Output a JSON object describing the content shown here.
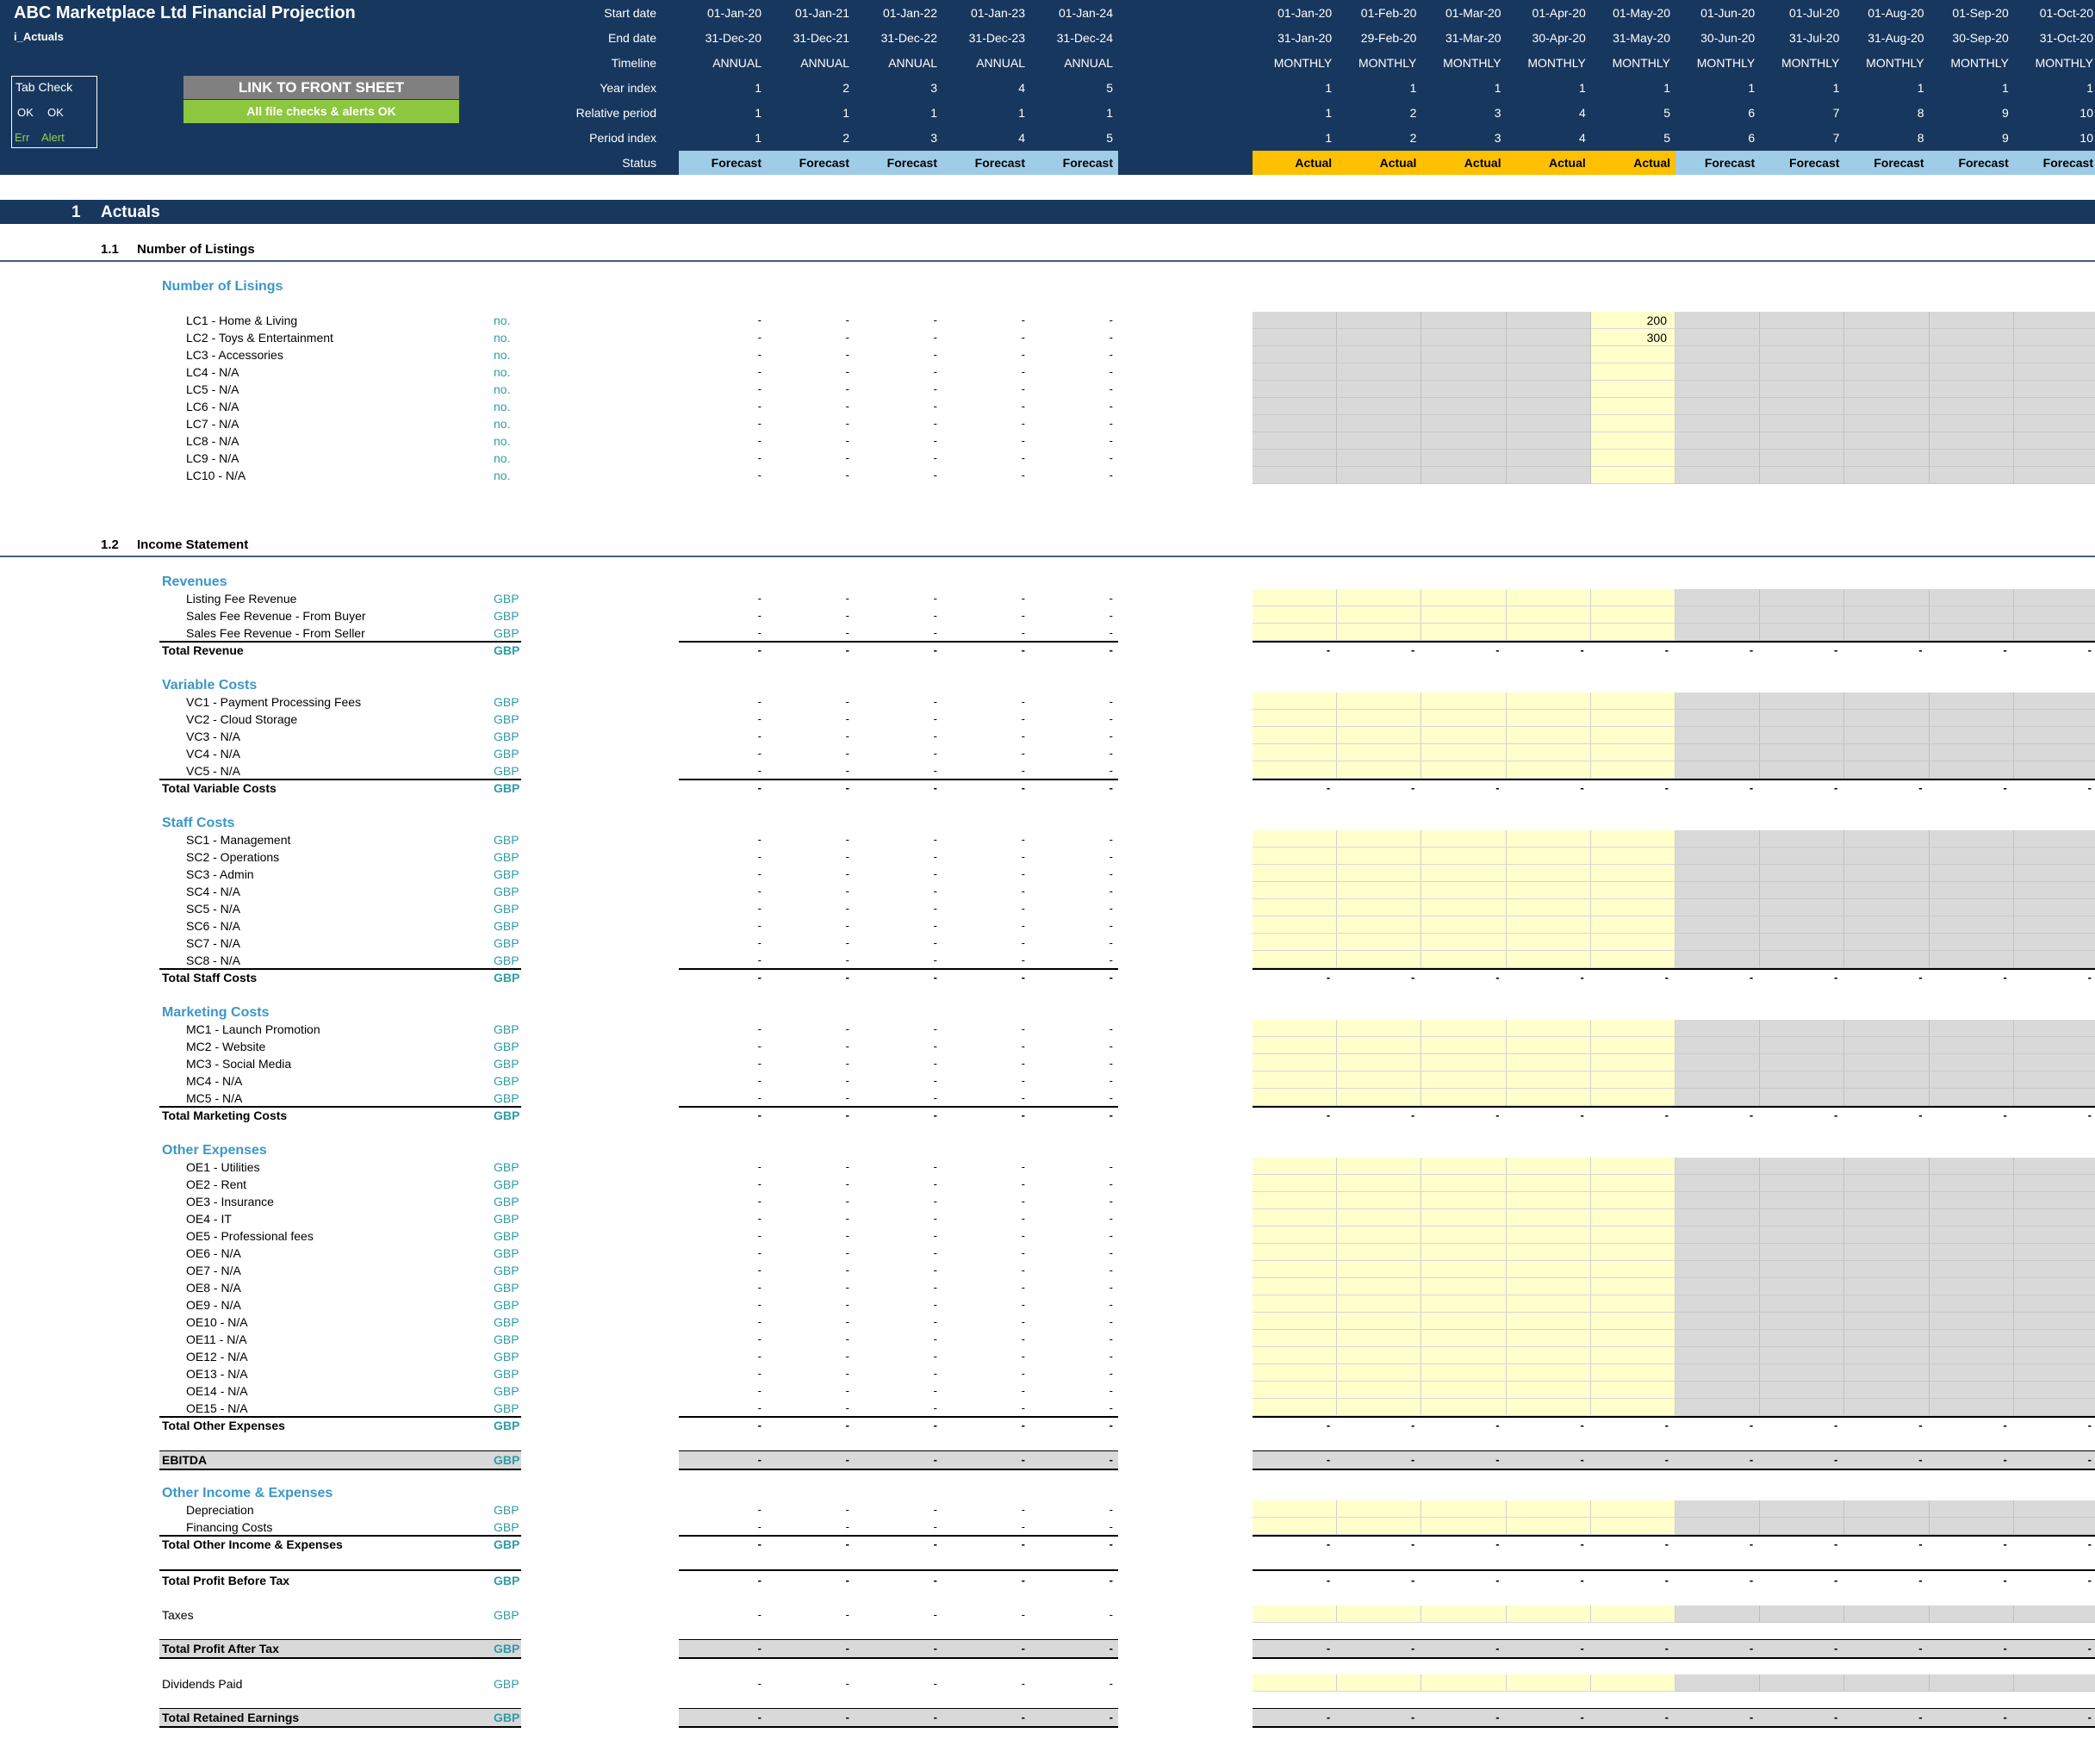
{
  "header": {
    "title": "ABC Marketplace Ltd Financial Projection",
    "sheet": "i_Actuals",
    "tabcheck": {
      "title": "Tab Check",
      "ok1": "OK",
      "ok2": "OK",
      "err": "Err",
      "alert": "Alert"
    },
    "link_button": "LINK TO FRONT SHEET",
    "checks_status": "All file checks & alerts OK",
    "row_labels": [
      "Start date",
      "End date",
      "Timeline",
      "Year index",
      "Relative period",
      "Period index",
      "Status"
    ],
    "annual": [
      {
        "start": "01-Jan-20",
        "end": "31-Dec-20",
        "timeline": "ANNUAL",
        "year": "1",
        "rel": "1",
        "idx": "1",
        "status": "Forecast"
      },
      {
        "start": "01-Jan-21",
        "end": "31-Dec-21",
        "timeline": "ANNUAL",
        "year": "2",
        "rel": "1",
        "idx": "2",
        "status": "Forecast"
      },
      {
        "start": "01-Jan-22",
        "end": "31-Dec-22",
        "timeline": "ANNUAL",
        "year": "3",
        "rel": "1",
        "idx": "3",
        "status": "Forecast"
      },
      {
        "start": "01-Jan-23",
        "end": "31-Dec-23",
        "timeline": "ANNUAL",
        "year": "4",
        "rel": "1",
        "idx": "4",
        "status": "Forecast"
      },
      {
        "start": "01-Jan-24",
        "end": "31-Dec-24",
        "timeline": "ANNUAL",
        "year": "5",
        "rel": "1",
        "idx": "5",
        "status": "Forecast"
      }
    ],
    "monthly": [
      {
        "start": "01-Jan-20",
        "end": "31-Jan-20",
        "timeline": "MONTHLY",
        "year": "1",
        "rel": "1",
        "idx": "1",
        "status": "Actual"
      },
      {
        "start": "01-Feb-20",
        "end": "29-Feb-20",
        "timeline": "MONTHLY",
        "year": "1",
        "rel": "2",
        "idx": "2",
        "status": "Actual"
      },
      {
        "start": "01-Mar-20",
        "end": "31-Mar-20",
        "timeline": "MONTHLY",
        "year": "1",
        "rel": "3",
        "idx": "3",
        "status": "Actual"
      },
      {
        "start": "01-Apr-20",
        "end": "30-Apr-20",
        "timeline": "MONTHLY",
        "year": "1",
        "rel": "4",
        "idx": "4",
        "status": "Actual"
      },
      {
        "start": "01-May-20",
        "end": "31-May-20",
        "timeline": "MONTHLY",
        "year": "1",
        "rel": "5",
        "idx": "5",
        "status": "Actual"
      },
      {
        "start": "01-Jun-20",
        "end": "30-Jun-20",
        "timeline": "MONTHLY",
        "year": "1",
        "rel": "6",
        "idx": "6",
        "status": "Forecast"
      },
      {
        "start": "01-Jul-20",
        "end": "31-Jul-20",
        "timeline": "MONTHLY",
        "year": "1",
        "rel": "7",
        "idx": "7",
        "status": "Forecast"
      },
      {
        "start": "01-Aug-20",
        "end": "31-Aug-20",
        "timeline": "MONTHLY",
        "year": "1",
        "rel": "8",
        "idx": "8",
        "status": "Forecast"
      },
      {
        "start": "01-Sep-20",
        "end": "30-Sep-20",
        "timeline": "MONTHLY",
        "year": "1",
        "rel": "9",
        "idx": "9",
        "status": "Forecast"
      },
      {
        "start": "01-Oct-20",
        "end": "31-Oct-20",
        "timeline": "MONTHLY",
        "year": "1",
        "rel": "10",
        "idx": "10",
        "status": "Forecast"
      }
    ]
  },
  "section": {
    "num": "1",
    "title": "Actuals"
  },
  "subsections": [
    {
      "num": "1.1",
      "title": "Number of Listings"
    },
    {
      "num": "1.2",
      "title": "Income Statement"
    }
  ],
  "dash": "-",
  "colors": {
    "navy": "#17375e",
    "input": "#ffffcc",
    "locked": "#d9d9d9",
    "actual": "#ffc000",
    "forecast_annual": "#9fcde8",
    "forecast_monthly": "#17375e",
    "ok_green": "#8dc63f",
    "link_grey": "#808080"
  },
  "listings": {
    "group": "Number of Lisings",
    "unit": "no.",
    "items": [
      "LC1 - Home & Living",
      "LC2 - Toys & Entertainment",
      "LC3 - Accessories",
      "LC4 - N/A",
      "LC5 - N/A",
      "LC6 - N/A",
      "LC7 - N/A",
      "LC8 - N/A",
      "LC9 - N/A",
      "LC10 - N/A"
    ],
    "may_values": [
      "200",
      "300",
      "",
      "",
      "",
      "",
      "",
      "",
      "",
      ""
    ]
  },
  "income": {
    "unit": "GBP",
    "revenues": {
      "group": "Revenues",
      "items": [
        "Listing Fee Revenue",
        "Sales Fee Revenue - From Buyer",
        "Sales Fee Revenue - From Seller"
      ],
      "total": "Total Revenue"
    },
    "variable": {
      "group": "Variable Costs",
      "items": [
        "VC1 - Payment Processing Fees",
        "VC2 - Cloud Storage",
        "VC3 - N/A",
        "VC4 - N/A",
        "VC5 - N/A"
      ],
      "total": "Total Variable Costs"
    },
    "staff": {
      "group": "Staff Costs",
      "items": [
        "SC1 - Management",
        "SC2 - Operations",
        "SC3 - Admin",
        "SC4 - N/A",
        "SC5 - N/A",
        "SC6 - N/A",
        "SC7 - N/A",
        "SC8 - N/A"
      ],
      "total": "Total Staff Costs"
    },
    "marketing": {
      "group": "Marketing Costs",
      "items": [
        "MC1 - Launch Promotion",
        "MC2 - Website",
        "MC3 - Social Media",
        "MC4 - N/A",
        "MC5 - N/A"
      ],
      "total": "Total Marketing Costs"
    },
    "other": {
      "group": "Other Expenses",
      "items": [
        "OE1 - Utilities",
        "OE2 - Rent",
        "OE3 - Insurance",
        "OE4 - IT",
        "OE5 - Professional fees",
        "OE6 - N/A",
        "OE7 - N/A",
        "OE8 - N/A",
        "OE9 - N/A",
        "OE10 - N/A",
        "OE11 - N/A",
        "OE12 - N/A",
        "OE13 - N/A",
        "OE14 - N/A",
        "OE15 - N/A"
      ],
      "total": "Total Other Expenses"
    },
    "ebitda": "EBITDA",
    "oie": {
      "group": "Other Income & Expenses",
      "items": [
        "Depreciation",
        "Financing Costs"
      ],
      "total": "Total Other Income & Expenses"
    },
    "pbt": "Total Profit Before Tax",
    "taxes": "Taxes",
    "pat": "Total Profit After Tax",
    "dividends": "Dividends Paid",
    "retained": "Total Retained Earnings"
  }
}
